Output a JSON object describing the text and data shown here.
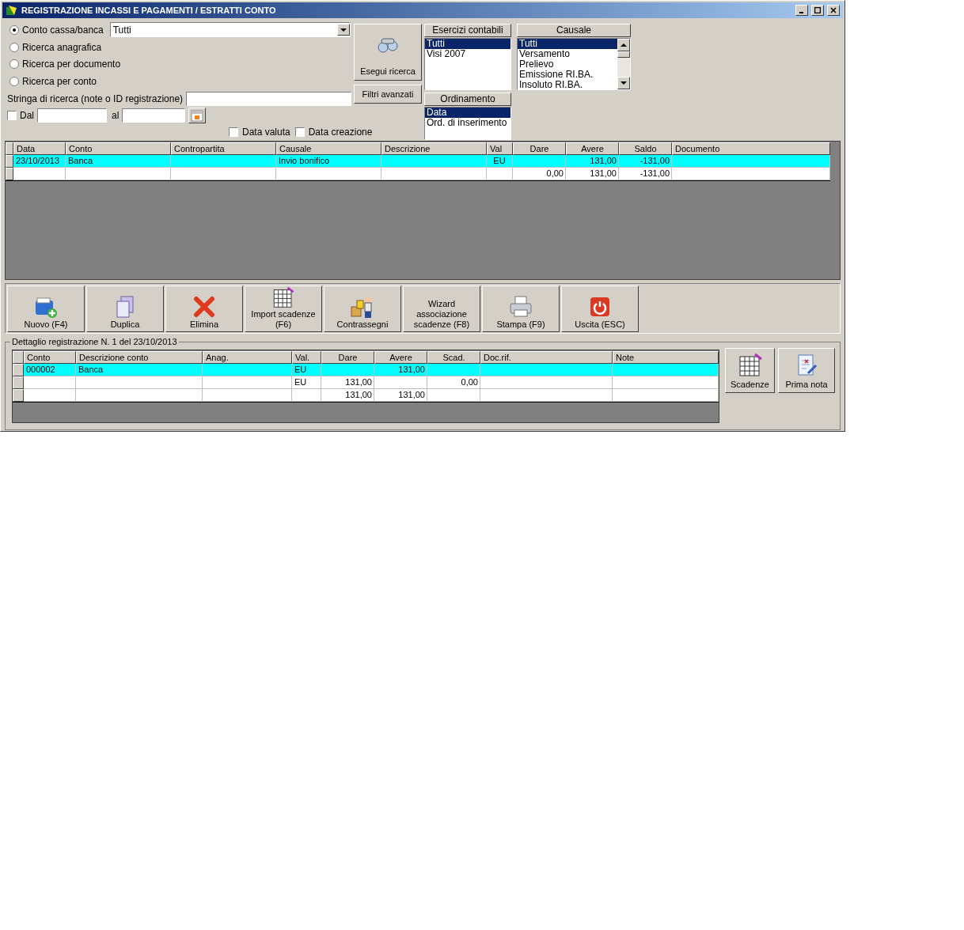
{
  "window": {
    "title": "REGISTRAZIONE INCASSI E PAGAMENTI / ESTRATTI CONTO"
  },
  "search_modes": [
    {
      "label": "Conto cassa/banca",
      "selected": true
    },
    {
      "label": "Ricerca anagrafica",
      "selected": false
    },
    {
      "label": "Ricerca per documento",
      "selected": false
    },
    {
      "label": "Ricerca per conto",
      "selected": false
    }
  ],
  "account_select": {
    "value": "Tutti"
  },
  "search_string": {
    "label": "Stringa di ricerca (note o ID registrazione)"
  },
  "date_range": {
    "checked": false,
    "from_label": "Dal",
    "to_label": "al"
  },
  "date_options": [
    {
      "label": "Data valuta",
      "checked": false
    },
    {
      "label": "Data creazione",
      "checked": false
    }
  ],
  "search_button": {
    "label": "Esegui ricerca"
  },
  "advanced_button": {
    "label": "Filtri avanzati"
  },
  "esercizi": {
    "title": "Esercizi contabili",
    "items": [
      {
        "label": "Tutti",
        "selected": true
      },
      {
        "label": "Visi 2007",
        "selected": false
      }
    ]
  },
  "ordinamento": {
    "title": "Ordinamento",
    "items": [
      {
        "label": "Data",
        "selected": true
      },
      {
        "label": "Ord. di inserimento",
        "selected": false
      }
    ]
  },
  "causale": {
    "title": "Causale",
    "items": [
      {
        "label": "Tutti",
        "selected": true
      },
      {
        "label": "Versamento",
        "selected": false
      },
      {
        "label": "Prelievo",
        "selected": false
      },
      {
        "label": "Emissione RI.BA.",
        "selected": false
      },
      {
        "label": "Insoluto RI.BA.",
        "selected": false
      }
    ]
  },
  "table": {
    "columns": [
      {
        "label": "Data",
        "kind": "text"
      },
      {
        "label": "Conto",
        "kind": "text"
      },
      {
        "label": "Contropartita",
        "kind": "text"
      },
      {
        "label": "Causale",
        "kind": "text"
      },
      {
        "label": "Descrizione",
        "kind": "text"
      },
      {
        "label": "Val",
        "kind": "center"
      },
      {
        "label": "Dare",
        "kind": "number"
      },
      {
        "label": "Avere",
        "kind": "number"
      },
      {
        "label": "Saldo",
        "kind": "number"
      },
      {
        "label": "Documento",
        "kind": "text"
      }
    ],
    "rows": [
      {
        "selected": true,
        "cells": [
          "23/10/2013",
          "Banca",
          "",
          "Invio bonifico",
          "",
          "EU",
          "",
          "131,00",
          "-131,00",
          ""
        ]
      },
      {
        "selected": false,
        "cells": [
          "",
          "",
          "",
          "",
          "",
          "",
          "0,00",
          "131,00",
          "-131,00",
          ""
        ]
      }
    ]
  },
  "toolbar": [
    {
      "label": "Nuovo (F4)",
      "kind": "new"
    },
    {
      "label": "Duplica",
      "kind": "copy"
    },
    {
      "label": "Elimina",
      "kind": "delete"
    },
    {
      "label": "Import scadenze (F6)",
      "kind": "sheet"
    },
    {
      "label": "Contrassegni",
      "kind": "courier"
    },
    {
      "label": "Wizard associazione scadenze (F8)",
      "kind": "none"
    },
    {
      "label": "Stampa (F9)",
      "kind": "print"
    },
    {
      "label": "Uscita (ESC)",
      "kind": "exit"
    }
  ],
  "detail": {
    "title": "Dettaglio registrazione N. 1 del 23/10/2013",
    "columns": [
      {
        "label": "Conto",
        "kind": "text"
      },
      {
        "label": "Descrizione conto",
        "kind": "text"
      },
      {
        "label": "Anag.",
        "kind": "text"
      },
      {
        "label": "Val.",
        "kind": "text"
      },
      {
        "label": "Dare",
        "kind": "number"
      },
      {
        "label": "Avere",
        "kind": "number"
      },
      {
        "label": "Scad.",
        "kind": "number"
      },
      {
        "label": "Doc.rif.",
        "kind": "text"
      },
      {
        "label": "Note",
        "kind": "text"
      }
    ],
    "rows": [
      {
        "selected": true,
        "cells": [
          "000002",
          "Banca",
          "",
          "EU",
          "",
          "131,00",
          "",
          "",
          ""
        ]
      },
      {
        "selected": false,
        "cells": [
          "",
          "",
          "",
          "EU",
          "131,00",
          "",
          "0,00",
          "",
          ""
        ]
      },
      {
        "selected": false,
        "cells": [
          "",
          "",
          "",
          "",
          "131,00",
          "131,00",
          "",
          "",
          ""
        ]
      }
    ],
    "buttons": [
      {
        "label": "Scadenze",
        "kind": "sheet"
      },
      {
        "label": "Prima nota",
        "kind": "note"
      }
    ]
  }
}
